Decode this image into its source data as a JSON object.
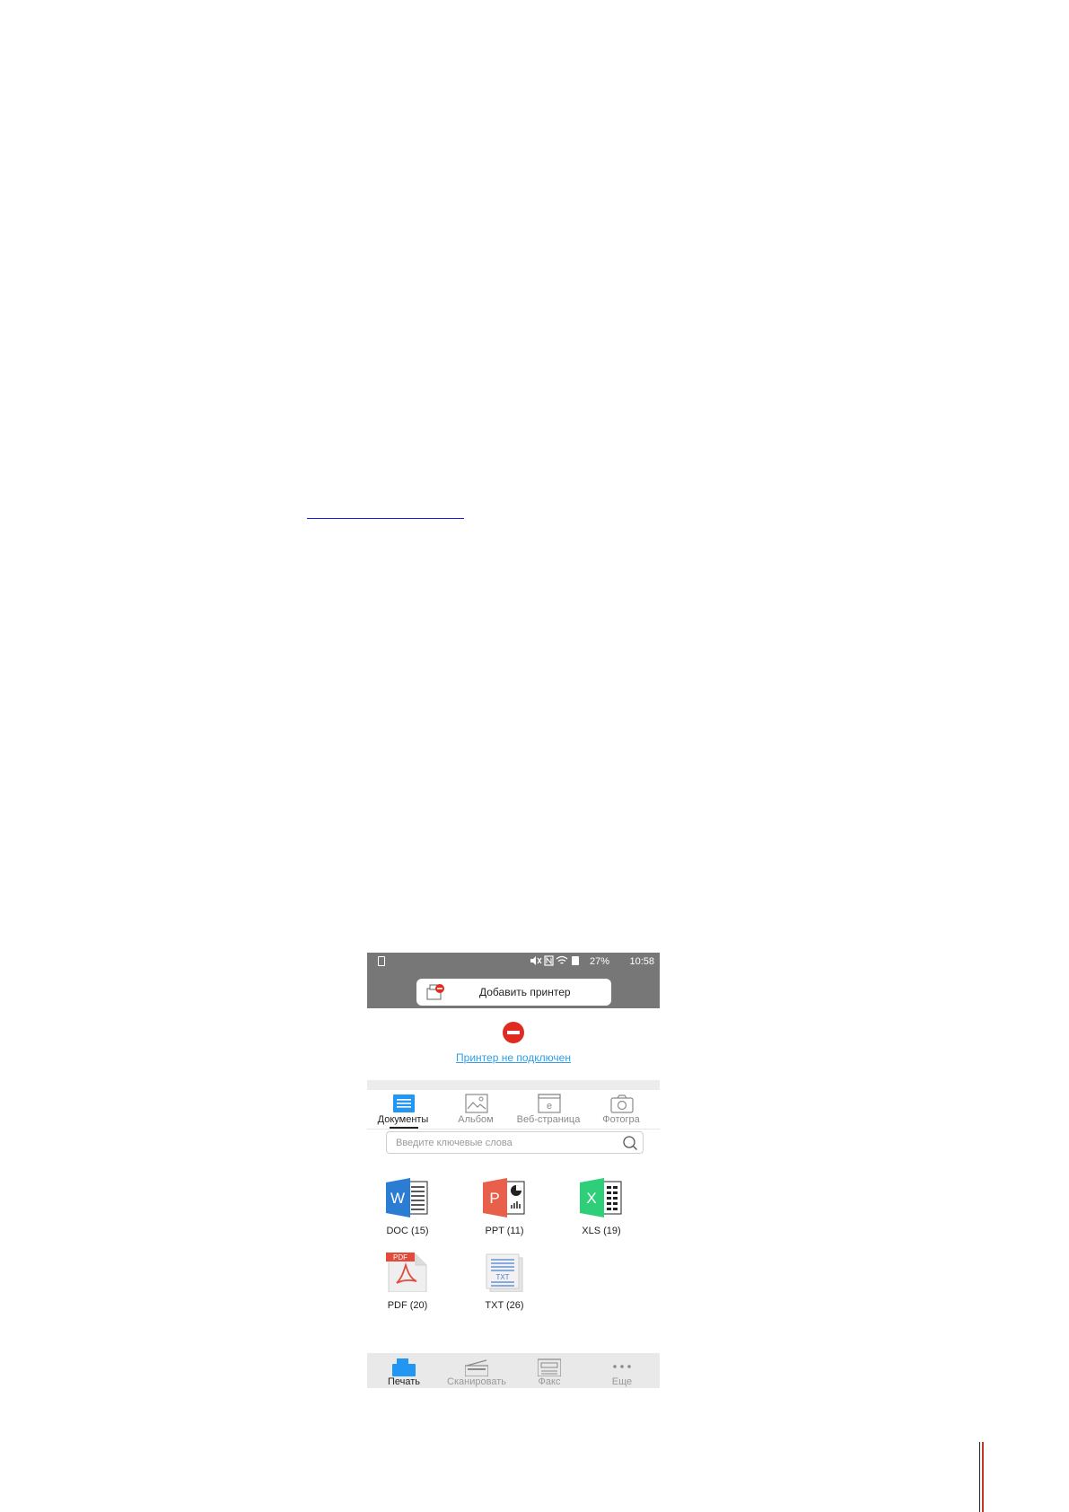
{
  "status_bar": {
    "battery": "27%",
    "time": "10:58"
  },
  "top_bar": {
    "add_printer_label": "Добавить принтер"
  },
  "printer_status": {
    "message": "Принтер не подключен"
  },
  "tabs": [
    {
      "label": "Документы",
      "icon": "document-icon",
      "active": true
    },
    {
      "label": "Альбом",
      "icon": "image-icon",
      "active": false
    },
    {
      "label": "Веб-страница",
      "icon": "web-page-icon",
      "active": false
    },
    {
      "label": "Фотогра",
      "icon": "camera-icon",
      "active": false
    }
  ],
  "search": {
    "placeholder": "Введите ключевые слова"
  },
  "files": [
    {
      "label": "DOC (15)",
      "icon": "word-icon",
      "color": "#2b7cd3"
    },
    {
      "label": "PPT (11)",
      "icon": "powerpoint-icon",
      "color": "#e8604c"
    },
    {
      "label": "XLS (19)",
      "icon": "excel-icon",
      "color": "#2fcf7a"
    },
    {
      "label": "PDF (20)",
      "icon": "pdf-icon",
      "color": "#e24a3b"
    },
    {
      "label": "TXT (26)",
      "icon": "txt-icon",
      "color": "#4a7fd1"
    }
  ],
  "bottom_nav": [
    {
      "label": "Печать",
      "icon": "print-icon",
      "active": true
    },
    {
      "label": "Сканировать",
      "icon": "scan-icon",
      "active": false
    },
    {
      "label": "Факс",
      "icon": "fax-icon",
      "active": false
    },
    {
      "label": "Еще",
      "icon": "more-icon",
      "active": false
    }
  ],
  "colors": {
    "accent": "#2196f3",
    "error": "#e02b20",
    "link": "#2f9ee6",
    "toolbar": "#777777"
  }
}
